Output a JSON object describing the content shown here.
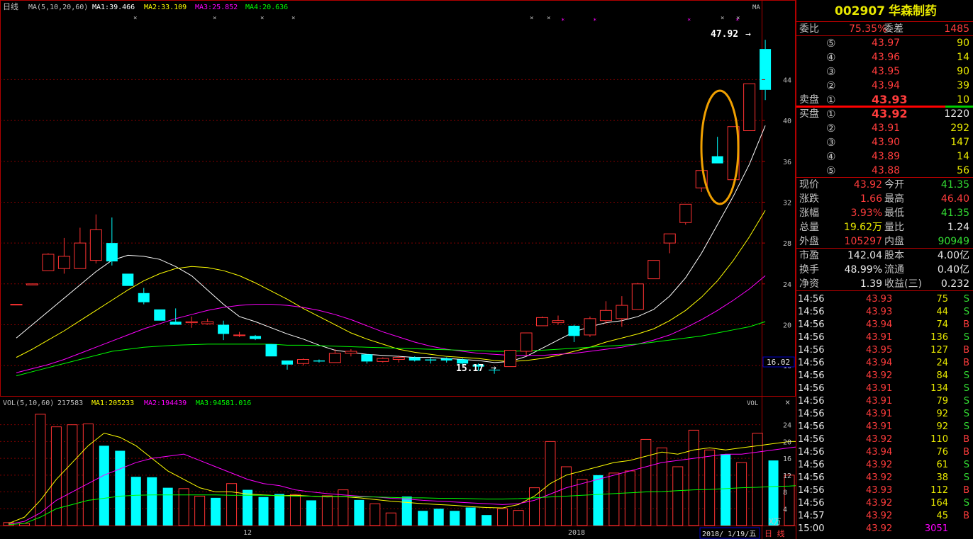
{
  "main": {
    "period": "日线",
    "ma_legend": {
      "label": "MA(5,10,20,60)",
      "ma1": "MA1:39.466",
      "ma2": "MA2:33.109",
      "ma3": "MA3:25.852",
      "ma4": "MA4:20.636",
      "corner": "MA"
    },
    "price_ticks": [
      "44",
      "40",
      "36",
      "32",
      "28",
      "24",
      "20",
      "16"
    ],
    "current_price_tag": "16.02",
    "high_annotation": "47.92",
    "low_annotation": "15.17",
    "x_labels": [
      "12",
      "2018"
    ],
    "date_box": "2018/ 1/19/五",
    "period_button": "日 线",
    "colors": {
      "ma1": "#ffffff",
      "ma2": "#ffff00",
      "ma3": "#ff00ff",
      "ma4": "#00ff00",
      "up": "#ff3232",
      "down": "#00ffff",
      "highlight": "#f0a000"
    }
  },
  "volume": {
    "legend": {
      "label": "VOL(5,10,60)",
      "value": "217583",
      "ma1": "MA1:205233",
      "ma2": "MA2:194439",
      "ma3": "MA3:94581.016",
      "corner": "VOL"
    },
    "ticks": [
      "24",
      "20",
      "16",
      "12",
      "8",
      "4"
    ],
    "unit": "X万",
    "close_icon": "close-icon"
  },
  "chart_data": {
    "type": "candlestick",
    "price_ylim": [
      15,
      48
    ],
    "candles": [
      {
        "o": 22.0,
        "c": 22.0,
        "h": 22.0,
        "l": 22.0,
        "up": true
      },
      {
        "o": 23.9,
        "c": 24.0,
        "h": 24.0,
        "l": 23.9,
        "up": true
      },
      {
        "o": 25.3,
        "c": 26.9,
        "h": 27.0,
        "l": 25.3,
        "up": true
      },
      {
        "o": 25.5,
        "c": 26.7,
        "h": 28.5,
        "l": 25.0,
        "up": true
      },
      {
        "o": 25.5,
        "c": 28.0,
        "h": 29.5,
        "l": 25.5,
        "up": true
      },
      {
        "o": 26.3,
        "c": 29.3,
        "h": 30.8,
        "l": 26.0,
        "up": true
      },
      {
        "o": 28.0,
        "c": 26.2,
        "h": 30.5,
        "l": 25.8,
        "up": false
      },
      {
        "o": 25.0,
        "c": 23.8,
        "h": 25.0,
        "l": 23.8,
        "up": false
      },
      {
        "o": 23.1,
        "c": 22.2,
        "h": 23.6,
        "l": 22.0,
        "up": false
      },
      {
        "o": 21.5,
        "c": 20.4,
        "h": 21.5,
        "l": 20.4,
        "up": false
      },
      {
        "o": 20.0,
        "c": 20.3,
        "h": 21.6,
        "l": 20.0,
        "up": false
      },
      {
        "o": 20.2,
        "c": 20.3,
        "h": 20.8,
        "l": 19.7,
        "up": true
      },
      {
        "o": 20.1,
        "c": 20.3,
        "h": 20.6,
        "l": 20.0,
        "up": true
      },
      {
        "o": 20.0,
        "c": 19.1,
        "h": 20.4,
        "l": 18.5,
        "up": false
      },
      {
        "o": 19.0,
        "c": 19.0,
        "h": 19.3,
        "l": 18.8,
        "up": true
      },
      {
        "o": 18.9,
        "c": 18.6,
        "h": 19.0,
        "l": 18.5,
        "up": false
      },
      {
        "o": 18.1,
        "c": 16.9,
        "h": 18.1,
        "l": 16.9,
        "up": false
      },
      {
        "o": 16.5,
        "c": 16.1,
        "h": 16.5,
        "l": 15.6,
        "up": false
      },
      {
        "o": 16.2,
        "c": 16.6,
        "h": 16.7,
        "l": 16.0,
        "up": true
      },
      {
        "o": 16.5,
        "c": 16.4,
        "h": 16.6,
        "l": 16.3,
        "up": false
      },
      {
        "o": 16.3,
        "c": 17.2,
        "h": 17.6,
        "l": 16.3,
        "up": true
      },
      {
        "o": 17.2,
        "c": 17.4,
        "h": 17.6,
        "l": 16.9,
        "up": true
      },
      {
        "o": 17.1,
        "c": 16.4,
        "h": 17.1,
        "l": 16.2,
        "up": false
      },
      {
        "o": 16.4,
        "c": 16.7,
        "h": 16.8,
        "l": 16.3,
        "up": true
      },
      {
        "o": 16.6,
        "c": 16.8,
        "h": 17.0,
        "l": 16.3,
        "up": true
      },
      {
        "o": 16.8,
        "c": 16.5,
        "h": 16.9,
        "l": 16.4,
        "up": false
      },
      {
        "o": 16.6,
        "c": 16.5,
        "h": 16.8,
        "l": 16.2,
        "up": false
      },
      {
        "o": 16.7,
        "c": 16.5,
        "h": 16.8,
        "l": 16.3,
        "up": false
      },
      {
        "o": 16.6,
        "c": 16.2,
        "h": 16.7,
        "l": 16.0,
        "up": false
      },
      {
        "o": 16.1,
        "c": 15.9,
        "h": 16.2,
        "l": 15.5,
        "up": false
      },
      {
        "o": 15.6,
        "c": 15.6,
        "h": 15.8,
        "l": 15.2,
        "up": false
      },
      {
        "o": 15.9,
        "c": 17.5,
        "h": 17.5,
        "l": 15.9,
        "up": true
      },
      {
        "o": 17.4,
        "c": 19.2,
        "h": 19.2,
        "l": 17.0,
        "up": true
      },
      {
        "o": 19.9,
        "c": 20.7,
        "h": 20.8,
        "l": 19.9,
        "up": true
      },
      {
        "o": 20.2,
        "c": 20.4,
        "h": 20.9,
        "l": 20.0,
        "up": true
      },
      {
        "o": 19.9,
        "c": 18.9,
        "h": 20.0,
        "l": 18.3,
        "up": false
      },
      {
        "o": 19.0,
        "c": 20.6,
        "h": 20.8,
        "l": 18.8,
        "up": true
      },
      {
        "o": 20.4,
        "c": 21.4,
        "h": 22.3,
        "l": 20.1,
        "up": true
      },
      {
        "o": 20.6,
        "c": 21.9,
        "h": 22.8,
        "l": 19.8,
        "up": true
      },
      {
        "o": 21.5,
        "c": 24.0,
        "h": 24.1,
        "l": 21.5,
        "up": true
      },
      {
        "o": 24.5,
        "c": 26.3,
        "h": 26.3,
        "l": 24.5,
        "up": true
      },
      {
        "o": 28.0,
        "c": 28.9,
        "h": 28.9,
        "l": 27.0,
        "up": true
      },
      {
        "o": 30.0,
        "c": 31.8,
        "h": 31.8,
        "l": 29.8,
        "up": true
      },
      {
        "o": 33.4,
        "c": 35.1,
        "h": 35.1,
        "l": 33.0,
        "up": true
      },
      {
        "o": 36.5,
        "c": 35.8,
        "h": 38.4,
        "l": 35.8,
        "up": false
      },
      {
        "o": 34.2,
        "c": 39.4,
        "h": 39.4,
        "l": 34.2,
        "up": true
      },
      {
        "o": 39.0,
        "c": 43.6,
        "h": 43.6,
        "l": 39.0,
        "up": true
      },
      {
        "o": 47.0,
        "c": 43.0,
        "h": 47.9,
        "l": 42.0,
        "up": false
      }
    ],
    "ma_lines": [
      {
        "name": "MA1",
        "values": [
          18.7,
          20.0,
          21.3,
          22.6,
          23.9,
          25.2,
          26.3,
          26.8,
          26.7,
          26.4,
          25.7,
          24.8,
          23.4,
          22.0,
          20.8,
          20.3,
          19.7,
          19.1,
          18.6,
          18.0,
          17.5,
          17.3,
          17.1,
          17.0,
          16.9,
          16.8,
          16.8,
          16.7,
          16.6,
          16.5,
          16.3,
          16.4,
          16.9,
          17.7,
          18.5,
          19.3,
          19.8,
          20.2,
          20.4,
          20.8,
          21.5,
          22.8,
          24.6,
          27.0,
          29.8,
          32.6,
          35.7,
          39.5
        ]
      },
      {
        "name": "MA2",
        "values": [
          16.8,
          17.6,
          18.5,
          19.4,
          20.4,
          21.4,
          22.4,
          23.4,
          24.3,
          25.0,
          25.5,
          25.7,
          25.6,
          25.3,
          24.8,
          24.1,
          23.3,
          22.5,
          21.6,
          20.8,
          20.0,
          19.2,
          18.6,
          18.1,
          17.6,
          17.3,
          17.1,
          16.9,
          16.8,
          16.7,
          16.5,
          16.4,
          16.5,
          16.7,
          17.0,
          17.4,
          17.8,
          18.3,
          18.7,
          19.1,
          19.6,
          20.4,
          21.4,
          22.7,
          24.3,
          26.3,
          28.6,
          31.2
        ]
      },
      {
        "name": "MA3",
        "values": [
          15.3,
          15.7,
          16.1,
          16.6,
          17.2,
          17.8,
          18.4,
          19.0,
          19.6,
          20.1,
          20.6,
          21.0,
          21.4,
          21.7,
          21.9,
          22.0,
          22.0,
          21.9,
          21.7,
          21.4,
          21.0,
          20.5,
          19.9,
          19.3,
          18.8,
          18.3,
          17.9,
          17.6,
          17.4,
          17.2,
          17.1,
          17.0,
          17.0,
          17.0,
          17.1,
          17.2,
          17.4,
          17.6,
          17.8,
          18.1,
          18.5,
          19.0,
          19.7,
          20.5,
          21.4,
          22.4,
          23.5,
          24.8
        ]
      },
      {
        "name": "MA4",
        "values": [
          15.0,
          15.4,
          15.8,
          16.2,
          16.6,
          17.0,
          17.4,
          17.6,
          17.8,
          17.9,
          18.0,
          18.05,
          18.1,
          18.1,
          18.1,
          18.1,
          18.1,
          18.0,
          18.0,
          17.95,
          17.9,
          17.85,
          17.8,
          17.75,
          17.7,
          17.65,
          17.6,
          17.55,
          17.5,
          17.45,
          17.4,
          17.4,
          17.45,
          17.5,
          17.6,
          17.7,
          17.8,
          17.9,
          18.0,
          18.1,
          18.3,
          18.5,
          18.7,
          18.9,
          19.2,
          19.5,
          19.8,
          20.3
        ]
      }
    ],
    "vol_ylim": [
      0,
      27
    ],
    "volume_bars": [
      0.7,
      0.5,
      26.5,
      23.5,
      24.0,
      24.2,
      19.0,
      17.8,
      11.6,
      11.5,
      9.0,
      8.8,
      7.0,
      6.6,
      10.0,
      8.5,
      6.8,
      7.5,
      7.4,
      6.0,
      7.1,
      8.5,
      6.1,
      5.2,
      3.0,
      6.9,
      3.5,
      4.0,
      3.5,
      4.3,
      2.5,
      4.0,
      3.6,
      9.0,
      20.0,
      14.0,
      11.0,
      12.0,
      12.5,
      13.0,
      20.5,
      18.5,
      14.0,
      22.7,
      18.0,
      17.0,
      15.0,
      22.0,
      15.5,
      12.0,
      25.8,
      24.0,
      21.0,
      13.5,
      21.0
    ],
    "volume_up": [
      true,
      true,
      true,
      true,
      true,
      true,
      false,
      false,
      false,
      false,
      false,
      true,
      true,
      false,
      true,
      false,
      false,
      false,
      true,
      false,
      true,
      true,
      false,
      true,
      true,
      false,
      false,
      false,
      false,
      false,
      false,
      true,
      true,
      true,
      true,
      true,
      true,
      false,
      true,
      true,
      true,
      true,
      true,
      true,
      true,
      false,
      true,
      true,
      false,
      true,
      false,
      true,
      true,
      true,
      false
    ],
    "vol_ma_lines": [
      {
        "name": "MA1",
        "values": [
          0.5,
          2,
          6,
          11,
          15,
          19,
          22,
          21,
          19,
          16,
          13,
          11,
          9,
          8,
          8,
          7.5,
          7.3,
          7.1,
          7.2,
          7.0,
          6.8,
          6.9,
          6.6,
          6.2,
          5.8,
          5.5,
          5.2,
          5.0,
          4.8,
          4.5,
          4.3,
          4.2,
          5,
          7,
          10,
          12,
          13,
          14,
          15,
          15.5,
          16.5,
          17.5,
          17,
          18,
          18.5,
          18,
          18.5,
          19,
          19.5,
          20,
          20,
          20,
          20.5,
          20,
          19.5
        ]
      },
      {
        "name": "MA2",
        "values": [
          0.3,
          1,
          3,
          6,
          8,
          10,
          12,
          13.5,
          15,
          16,
          16.5,
          17,
          15.5,
          14,
          12.5,
          11,
          10,
          9.5,
          8.5,
          8,
          7.6,
          7.3,
          7.0,
          6.8,
          6.5,
          6.3,
          6.0,
          5.8,
          5.6,
          5.4,
          5.2,
          5.0,
          5.2,
          6,
          7.5,
          9,
          10,
          11,
          12,
          13,
          14,
          15,
          15.5,
          16,
          16.5,
          17,
          17,
          17.5,
          18,
          18.5,
          19,
          19,
          19.5,
          19.5,
          19.5
        ]
      },
      {
        "name": "MA3",
        "values": [
          0.2,
          0.5,
          2,
          4,
          5,
          6,
          6.5,
          7,
          7.2,
          7.3,
          7.3,
          7.3,
          7.3,
          7.3,
          7.2,
          7.2,
          7.2,
          7.1,
          7.0,
          7.0,
          6.9,
          6.9,
          6.8,
          6.8,
          6.7,
          6.6,
          6.6,
          6.5,
          6.5,
          6.4,
          6.3,
          6.3,
          6.4,
          6.6,
          6.8,
          7,
          7.2,
          7.4,
          7.6,
          7.8,
          8,
          8.1,
          8.3,
          8.5,
          8.6,
          8.8,
          9,
          9.1,
          9.3,
          9.4,
          9.6,
          9.7,
          9.8,
          9.8,
          9.8
        ]
      }
    ]
  },
  "quote": {
    "code": "002907",
    "name": "华森制药",
    "webi_label": "委比",
    "webi_value": "75.35%",
    "wecha_label": "委差",
    "wecha_value": "1485",
    "sell_label": "卖盘",
    "buy_label": "买盘",
    "asks": [
      {
        "idx": "⑤",
        "price": "43.97",
        "vol": "90"
      },
      {
        "idx": "④",
        "price": "43.96",
        "vol": "14"
      },
      {
        "idx": "③",
        "price": "43.95",
        "vol": "90"
      },
      {
        "idx": "②",
        "price": "43.94",
        "vol": "39"
      },
      {
        "idx": "①",
        "price": "43.93",
        "vol": "10"
      }
    ],
    "bids": [
      {
        "idx": "①",
        "price": "43.92",
        "vol": "1220"
      },
      {
        "idx": "②",
        "price": "43.91",
        "vol": "292"
      },
      {
        "idx": "③",
        "price": "43.90",
        "vol": "147"
      },
      {
        "idx": "④",
        "price": "43.89",
        "vol": "14"
      },
      {
        "idx": "⑤",
        "price": "43.88",
        "vol": "56"
      }
    ],
    "stats": [
      {
        "l1": "现价",
        "v1": "43.92",
        "c1": "red",
        "l2": "今开",
        "v2": "41.35",
        "c2": "grn"
      },
      {
        "l1": "涨跌",
        "v1": "1.66",
        "c1": "red",
        "l2": "最高",
        "v2": "46.40",
        "c2": "red"
      },
      {
        "l1": "涨幅",
        "v1": "3.93%",
        "c1": "red",
        "l2": "最低",
        "v2": "41.35",
        "c2": "grn"
      },
      {
        "l1": "总量",
        "v1": "19.62万",
        "c1": "yel",
        "l2": "量比",
        "v2": "1.24",
        "c2": "wht"
      },
      {
        "l1": "外盘",
        "v1": "105297",
        "c1": "red",
        "l2": "内盘",
        "v2": "90949",
        "c2": "grn"
      }
    ],
    "stats2": [
      {
        "l1": "市盈",
        "v1": "142.04",
        "l2": "股本",
        "v2": "4.00亿"
      },
      {
        "l1": "换手",
        "v1": "48.99%",
        "l2": "流通",
        "v2": "0.40亿"
      },
      {
        "l1": "净资",
        "v1": "1.39",
        "l2": "收益(三)",
        "v2": "0.232"
      }
    ],
    "ticks": [
      {
        "t": "14:56",
        "p": "43.93",
        "v": "75",
        "s": "S"
      },
      {
        "t": "14:56",
        "p": "43.93",
        "v": "44",
        "s": "S"
      },
      {
        "t": "14:56",
        "p": "43.94",
        "v": "74",
        "s": "B"
      },
      {
        "t": "14:56",
        "p": "43.91",
        "v": "136",
        "s": "S"
      },
      {
        "t": "14:56",
        "p": "43.95",
        "v": "127",
        "s": "B"
      },
      {
        "t": "14:56",
        "p": "43.94",
        "v": "24",
        "s": "B"
      },
      {
        "t": "14:56",
        "p": "43.92",
        "v": "84",
        "s": "S"
      },
      {
        "t": "14:56",
        "p": "43.91",
        "v": "134",
        "s": "S"
      },
      {
        "t": "14:56",
        "p": "43.91",
        "v": "79",
        "s": "S"
      },
      {
        "t": "14:56",
        "p": "43.91",
        "v": "92",
        "s": "S"
      },
      {
        "t": "14:56",
        "p": "43.91",
        "v": "92",
        "s": "S"
      },
      {
        "t": "14:56",
        "p": "43.92",
        "v": "110",
        "s": "B"
      },
      {
        "t": "14:56",
        "p": "43.94",
        "v": "76",
        "s": "B"
      },
      {
        "t": "14:56",
        "p": "43.92",
        "v": "61",
        "s": "S"
      },
      {
        "t": "14:56",
        "p": "43.92",
        "v": "38",
        "s": "S"
      },
      {
        "t": "14:56",
        "p": "43.93",
        "v": "112",
        "s": "B"
      },
      {
        "t": "14:56",
        "p": "43.92",
        "v": "164",
        "s": "S"
      },
      {
        "t": "14:57",
        "p": "43.92",
        "v": "45",
        "s": "B"
      },
      {
        "t": "15:00",
        "p": "43.92",
        "v": "3051",
        "s": ""
      }
    ]
  }
}
